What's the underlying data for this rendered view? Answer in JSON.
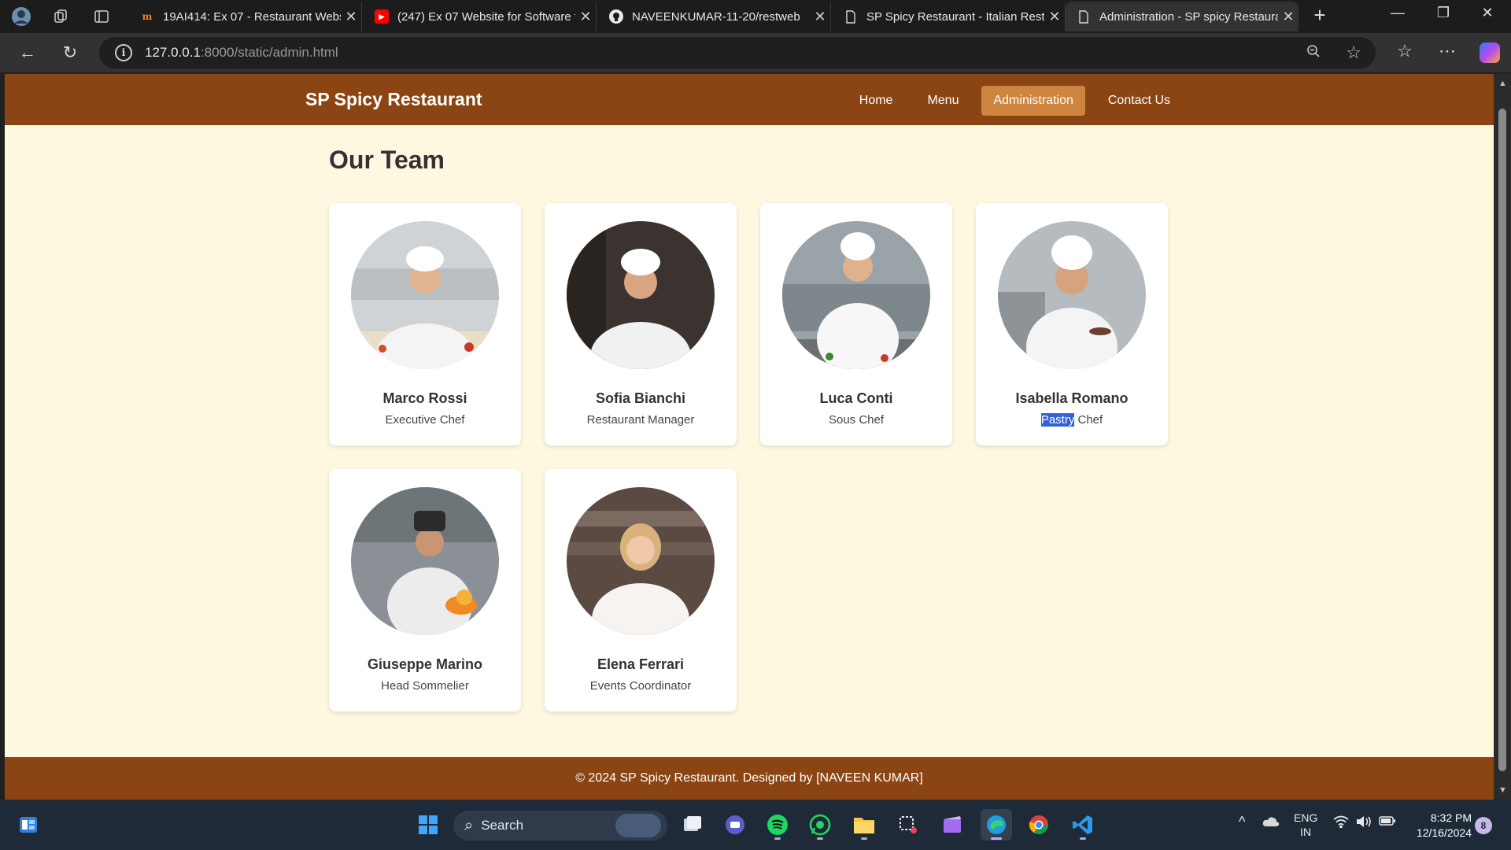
{
  "browser": {
    "tabs": [
      {
        "label": "19AI414: Ex 07 - Restaurant Webs",
        "icon": "moodle-icon"
      },
      {
        "label": "(247) Ex 07 Website for Software f",
        "icon": "youtube-icon"
      },
      {
        "label": "NAVEENKUMAR-11-20/restweb",
        "icon": "github-icon"
      },
      {
        "label": "SP Spicy Restaurant - Italian Resta",
        "icon": "page-icon"
      },
      {
        "label": "Administration - SP spicy Restaura",
        "icon": "page-icon"
      }
    ],
    "url_host": "127.0.0.1",
    "url_rest": ":8000/static/admin.html"
  },
  "site": {
    "brand": "SP Spicy Restaurant",
    "nav": [
      "Home",
      "Menu",
      "Administration",
      "Contact Us"
    ],
    "active_nav": "Administration",
    "heading": "Our Team",
    "team": [
      {
        "name": "Marco Rossi",
        "role": "Executive Chef"
      },
      {
        "name": "Sofia Bianchi",
        "role": "Restaurant Manager"
      },
      {
        "name": "Luca Conti",
        "role": "Sous Chef"
      },
      {
        "name": "Isabella Romano",
        "role_selected": "Pastry",
        "role_rest": " Chef"
      },
      {
        "name": "Giuseppe Marino",
        "role": "Head Sommelier"
      },
      {
        "name": "Elena Ferrari",
        "role": "Events Coordinator"
      }
    ],
    "footer": "© 2024 SP Spicy Restaurant. Designed by [NAVEEN KUMAR]"
  },
  "taskbar": {
    "search_label": "Search",
    "lang_top": "ENG",
    "lang_bottom": "IN",
    "time": "8:32 PM",
    "date": "12/16/2024",
    "notifications": "8"
  },
  "colors": {
    "header_brown": "#8b4513",
    "active_nav": "#cd853f",
    "page_bg": "#fff8e1",
    "selection": "#3260d6"
  }
}
